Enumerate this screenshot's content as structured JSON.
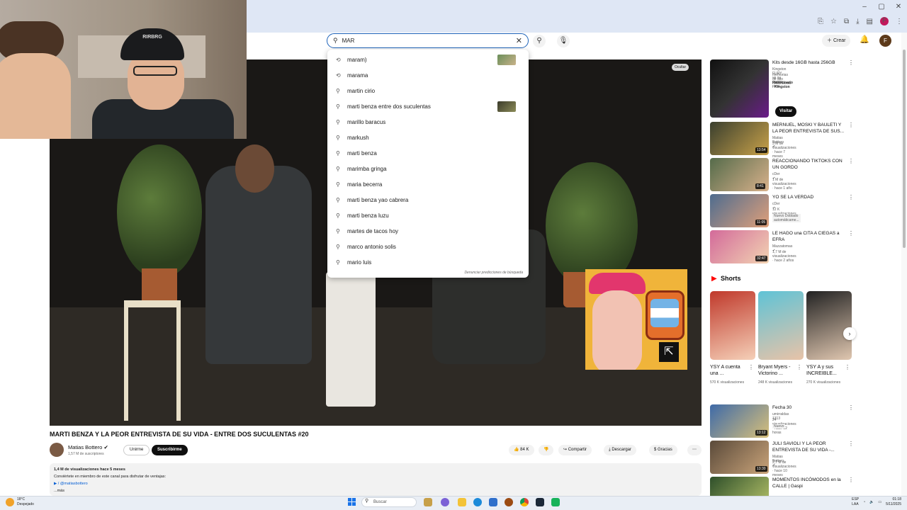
{
  "window": {
    "minimize": "–",
    "maximize": "▢",
    "close": "✕"
  },
  "chrome_icons": [
    "cast-icon",
    "star-icon",
    "extensions-icon",
    "download-icon",
    "tab-search-icon",
    "profile-avatar"
  ],
  "chrome_profile_letter": "F",
  "search": {
    "query": "MAR",
    "clear": "✕"
  },
  "header": {
    "create_label": "Crear",
    "avatar_letter": "F"
  },
  "suggestions": [
    {
      "text": "maram)",
      "icon": "history",
      "thumb": true
    },
    {
      "text": "marama",
      "icon": "history",
      "thumb": false
    },
    {
      "text": "martin cirio",
      "icon": "search",
      "thumb": false
    },
    {
      "text": "marti benza entre dos suculentas",
      "icon": "search",
      "thumb": true
    },
    {
      "text": "marillo baracus",
      "icon": "search",
      "thumb": false
    },
    {
      "text": "markush",
      "icon": "search",
      "thumb": false
    },
    {
      "text": "marti benza",
      "icon": "search",
      "thumb": false
    },
    {
      "text": "marimba gringa",
      "icon": "search",
      "thumb": false
    },
    {
      "text": "maria becerra",
      "icon": "search",
      "thumb": false
    },
    {
      "text": "marti benza yao cabrera",
      "icon": "search",
      "thumb": false
    },
    {
      "text": "marti benza luzu",
      "icon": "search",
      "thumb": false
    },
    {
      "text": "martes de tacos hoy",
      "icon": "search",
      "thumb": false
    },
    {
      "text": "marco antonio solis",
      "icon": "search",
      "thumb": false
    },
    {
      "text": "mario luis",
      "icon": "search",
      "thumb": false
    }
  ],
  "suggestions_report": "Denunciar predicciones de búsqueda",
  "video": {
    "resume_label": "Ocultar",
    "webcam_cap_text": "RIRBRG",
    "title": "MARTI BENZA Y LA PEOR ENTREVISTA DE SU VIDA - ENTRE DOS SUCULENTAS #20",
    "channel": "Matias Bottero ✔",
    "subs": "1,57 M de suscriptores",
    "join": "Unirme",
    "subscribe": "Suscribirme",
    "likes": "84 K",
    "share": "Compartir",
    "download": "Descargar",
    "thanks": "Gracias",
    "more": "⋯",
    "views_line": "1,4 M de visualizaciones  hace 5 meses",
    "desc_line1": "Conviértete en miembro de este canal para disfrutar de ventajas:",
    "desc_link": "▶ / @matiasbottero",
    "desc_more": "...más"
  },
  "sidebar": {
    "ad": {
      "title": "Kits desde 16GB hasta 256GB",
      "line2": "Kingston FURY va su opción para",
      "line3": "memorias de alto rendimiento",
      "sponsor": "Patrocinado · Kingston",
      "cta": "Visitar sitio web"
    },
    "videos": [
      {
        "title": "MERNUEL, MOSKI Y BAULETI Y LA PEOR ENTREVISTA DE SUS...",
        "channel": "Matias Bottero ✔",
        "meta": "3 M de visualizaciones · hace 7 meses",
        "duration": "13:54",
        "badge": ""
      },
      {
        "title": "REACCIONANDO TIKTOKS CON UN GORDO",
        "channel": "cDer ✔",
        "meta": "1 M de visualizaciones · hace 1 año",
        "duration": "8:41",
        "badge": ""
      },
      {
        "title": "YO SE LA VERDAD",
        "channel": "cDer ✔",
        "meta": "12 K visualizaciones · hace 5 horas",
        "duration": "11:05",
        "badge": "Nuevo   Doblado automáticame..."
      },
      {
        "title": "LE HAGO una CITA A CIEGAS a EFRA",
        "channel": "Mazzatomas ✔",
        "meta": "1,7 M de visualizaciones · hace 2 años",
        "duration": "32:47",
        "badge": ""
      }
    ],
    "shorts_title": "Shorts",
    "shorts": [
      {
        "title": "YSY A cuenta una ...",
        "views": "570 K visualizaciones"
      },
      {
        "title": "Bryant Myers - Victorino ...",
        "views": "248 K visualizaciones"
      },
      {
        "title": "YSY A y sus INCREIBLE...",
        "views": "270 K visualizaciones"
      }
    ],
    "videos2": [
      {
        "title": "Fecha 30",
        "channel": "umirraldas 1313",
        "meta": "24 visualizaciones · hace 12 horas",
        "duration": "13:12",
        "badge": "Nuevo"
      },
      {
        "title": "JULI SAVIOLI Y LA PEOR ENTREVISTA DE SU VIDA -...",
        "channel": "Matias Bottero ✔",
        "meta": "2,7 M de visualizaciones · hace 10 meses",
        "duration": "13:30",
        "badge": ""
      },
      {
        "title": "MOMENTOS INCÓMODOS en la CALLE | Gaspi",
        "channel": "",
        "meta": "",
        "duration": "",
        "badge": ""
      }
    ]
  },
  "taskbar": {
    "weather_temp": "18°C",
    "weather_desc": "Despejado",
    "search_label": "Buscar",
    "lang1": "ESP",
    "lang2": "LAA",
    "time": "01:18",
    "date": "5/11/2025"
  },
  "colors": {
    "accent": "#065fd4",
    "brand_red": "#ff0000",
    "search_border": "#1c62b9"
  }
}
